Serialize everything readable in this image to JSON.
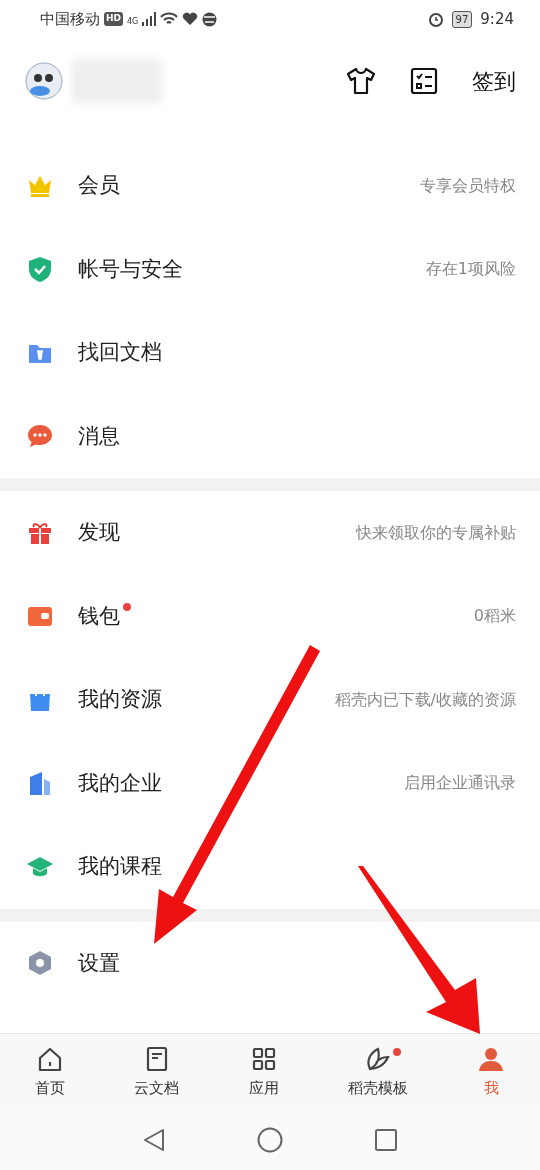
{
  "status_bar": {
    "carrier": "中国移动",
    "hd": "HD",
    "network": "4G",
    "battery": "97",
    "time": "9:24"
  },
  "header": {
    "sign_in": "签到"
  },
  "sections": [
    {
      "items": [
        {
          "label": "会员",
          "detail": "专享会员特权",
          "color": "#f5c400",
          "dot": false
        },
        {
          "label": "帐号与安全",
          "detail": "存在1项风险",
          "color": "#1fb37a",
          "dot": false
        },
        {
          "label": "找回文档",
          "color": "#5b8ff2",
          "dot": false
        },
        {
          "label": "消息",
          "color": "#ec5a3c",
          "dot": false
        }
      ]
    },
    {
      "items": [
        {
          "label": "发现",
          "detail": "快来领取你的专属补贴",
          "color": "#ea3f3a",
          "dot": false
        },
        {
          "label": "钱包",
          "detail": "0稻米",
          "color": "#f0673d",
          "dot": true
        },
        {
          "label": "我的资源",
          "detail": "稻壳内已下载/收藏的资源",
          "color": "#3d8ef0",
          "dot": false
        },
        {
          "label": "我的企业",
          "detail": "启用企业通讯录",
          "color": "#3d7fe6",
          "dot": false
        },
        {
          "label": "我的课程",
          "color": "#26b37a",
          "dot": false
        }
      ]
    },
    {
      "items": [
        {
          "label": "设置",
          "color": "#8a93a8",
          "dot": false
        }
      ]
    }
  ],
  "bottom_nav": [
    {
      "label": "首页",
      "selected": false,
      "dot": false
    },
    {
      "label": "云文档",
      "selected": false,
      "dot": false
    },
    {
      "label": "应用",
      "selected": false,
      "dot": false
    },
    {
      "label": "稻壳模板",
      "selected": false,
      "dot": true
    },
    {
      "label": "我",
      "selected": true,
      "dot": false
    }
  ]
}
